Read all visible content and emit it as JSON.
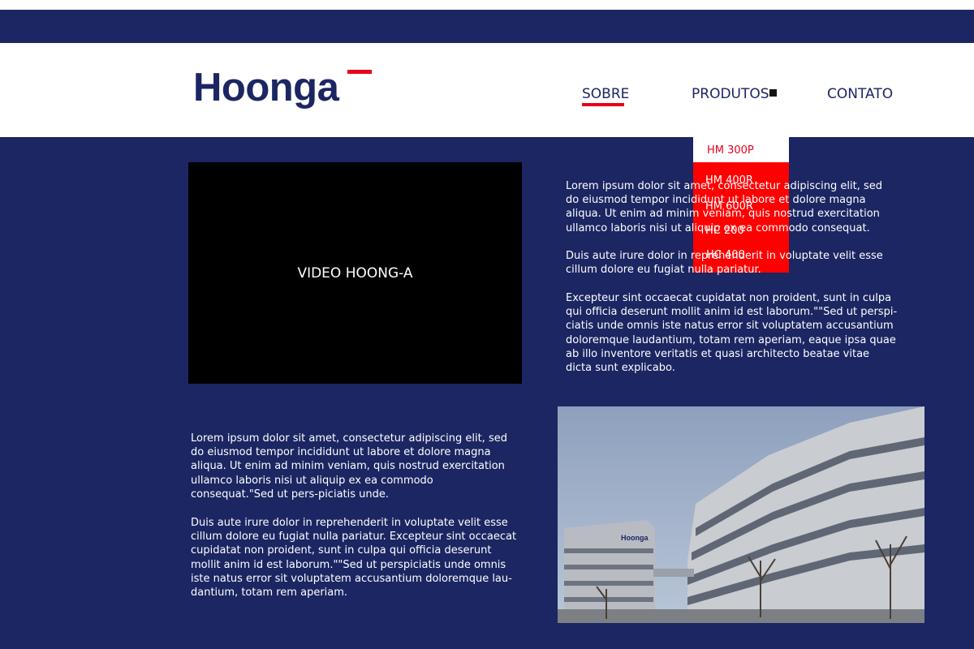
{
  "brand": {
    "logo_text": "Hoonga",
    "primary_color": "#1b2662",
    "accent_color": "#e8001c"
  },
  "nav": {
    "sobre": "SOBRE",
    "produtos": "PRODUTOS",
    "contato": "CONTATO"
  },
  "dropdown": {
    "items": [
      "HM 300P",
      "HM 400R",
      "HM 600R",
      "HC 200",
      "HC 400"
    ],
    "highlight_color": "#ff0000"
  },
  "video": {
    "label": "VIDEO HOONG-A"
  },
  "right_text": {
    "p1": "Lorem ipsum dolor sit amet, consectetur adipiscing elit, sed do eiusmod tempor incididunt ut labore et dolore magna aliqua. Ut enim ad minim veniam, quis nostrud exercitation ullamco laboris nisi ut aliquip ex ea commodo consequat.",
    "p2": "Duis aute irure dolor in reprehenderit in voluptate velit esse cillum dolore eu fugiat nulla pariatur.",
    "p3": "Excepteur sint occaecat cupidatat non proident, sunt in culpa qui officia deserunt mollit anim id est laborum.\"\"Sed ut perspi-ciatis unde omnis iste natus error sit voluptatem accusantium doloremque laudantium, totam rem aperiam, eaque ipsa quae ab illo inventore veritatis et quasi architecto beatae vitae dicta sunt explicabo."
  },
  "left_text": {
    "p1": "Lorem ipsum dolor sit amet, consectetur adipiscing elit, sed do eiusmod tempor incididunt ut labore et dolore magna aliqua. Ut enim ad minim veniam, quis nostrud exercitation ullamco laboris nisi ut aliquip ex ea commodo consequat.\"Sed ut pers-piciatis unde.",
    "p2": "Duis aute irure dolor in reprehenderit in voluptate velit esse cillum dolore eu fugiat nulla pariatur. Excepteur sint occaecat cupidatat non proident, sunt in culpa qui officia deserunt mollit anim id est laborum.\"\"Sed ut perspiciatis unde omnis iste natus error sit voluptatem accusantium doloremque lau-dantium, totam rem aperiam."
  },
  "photo": {
    "sign_text": "Hoonga"
  }
}
